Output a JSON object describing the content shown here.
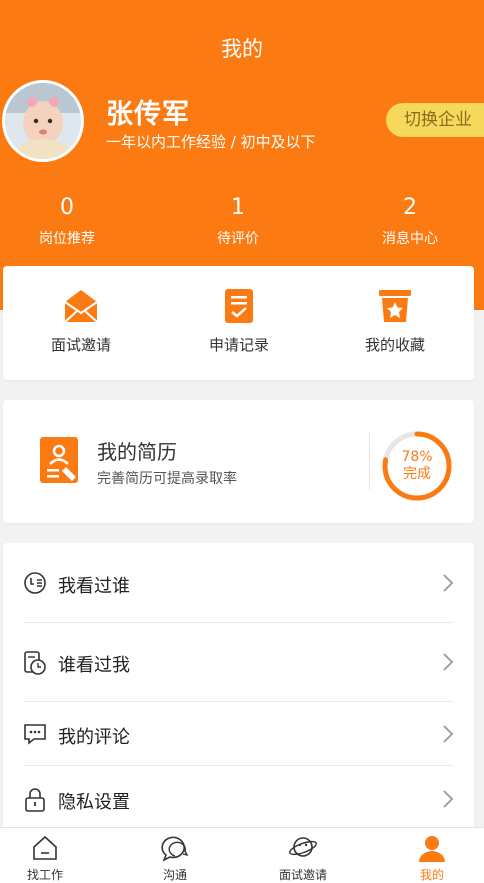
{
  "nav": {
    "title": "我的"
  },
  "profile": {
    "name": "张传军",
    "description": "一年以内工作经验 / 初中及以下",
    "switch_label": "切换企业"
  },
  "stats": [
    {
      "value": "0",
      "label": "岗位推荐"
    },
    {
      "value": "1",
      "label": "待评价"
    },
    {
      "value": "2",
      "label": "消息中心"
    }
  ],
  "quick_actions": [
    {
      "label": "面试邀请",
      "icon": "envelope-icon"
    },
    {
      "label": "申请记录",
      "icon": "clipboard-check-icon"
    },
    {
      "label": "我的收藏",
      "icon": "star-box-icon"
    }
  ],
  "resume": {
    "title": "我的简历",
    "subtitle": "完善简历可提高录取率",
    "percent_label": "78%",
    "status_label": "完成",
    "progress": 0.78
  },
  "menu": [
    {
      "label": "我看过谁",
      "icon": "clock-list-icon"
    },
    {
      "label": "谁看过我",
      "icon": "calendar-clock-icon"
    },
    {
      "label": "我的评论",
      "icon": "comment-icon"
    },
    {
      "label": "隐私设置",
      "icon": "lock-icon"
    }
  ],
  "tabbar": [
    {
      "label": "找工作",
      "icon": "home-icon",
      "active": false
    },
    {
      "label": "沟通",
      "icon": "chat-icon",
      "active": false
    },
    {
      "label": "面试邀请",
      "icon": "planet-icon",
      "active": false
    },
    {
      "label": "我的",
      "icon": "person-icon",
      "active": true
    }
  ],
  "colors": {
    "brand": "#fb7a12",
    "switch_bg": "#f6d85a",
    "background": "#f2f2f2"
  }
}
